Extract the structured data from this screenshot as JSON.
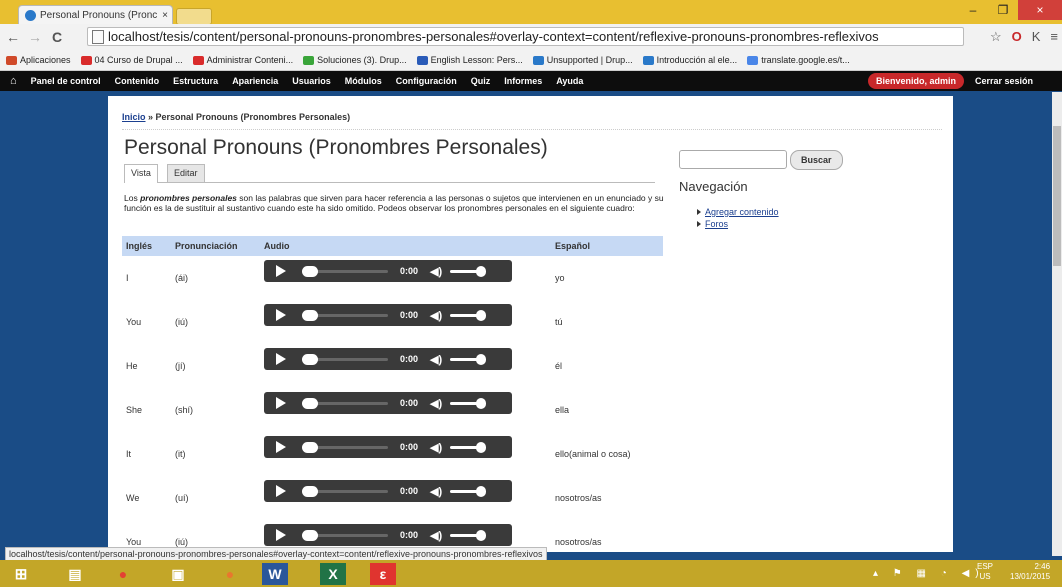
{
  "browser": {
    "tab_title": "Personal Pronouns (Pronc",
    "tab_close": "×",
    "window": {
      "minimize": "–",
      "maximize": "❐",
      "close": "×"
    },
    "url": "localhost/tesis/content/personal-pronouns-pronombres-personales#overlay-context=content/reflexive-pronouns-pronombres-reflexivos",
    "bookmarks": [
      {
        "label": "Aplicaciones",
        "color": "#d04a2a"
      },
      {
        "label": "04 Curso de Drupal ...",
        "color": "#d92b2b"
      },
      {
        "label": "Administrar Conteni...",
        "color": "#d92b2b"
      },
      {
        "label": "Soluciones (3). Drup...",
        "color": "#3aa53a"
      },
      {
        "label": "English Lesson: Pers...",
        "color": "#2a5bb8"
      },
      {
        "label": "Unsupported | Drup...",
        "color": "#2a79c9"
      },
      {
        "label": "Introducción al ele...",
        "color": "#2a79c9"
      },
      {
        "label": "translate.google.es/t...",
        "color": "#4a86e8"
      }
    ],
    "status_url": "localhost/tesis/content/personal-pronouns-pronombres-personales#overlay-context=content/reflexive-pronouns-pronombres-reflexivos"
  },
  "admin_bar": {
    "items": [
      "Panel de control",
      "Contenido",
      "Estructura",
      "Apariencia",
      "Usuarios",
      "Módulos",
      "Configuración",
      "Quiz",
      "Informes",
      "Ayuda"
    ],
    "welcome_prefix": "Bienvenido, ",
    "welcome_user": "admin",
    "logout": "Cerrar sesión"
  },
  "page": {
    "breadcrumb_link": "Inicio",
    "breadcrumb_sep": " » ",
    "breadcrumb_current": "Personal Pronouns (Pronombres Personales)",
    "title": "Personal Pronouns (Pronombres Personales)",
    "tabs": [
      "Vista",
      "Editar"
    ],
    "intro_prefix": "Los ",
    "intro_em": "pronombres personales",
    "intro_rest": " son las palabras que sirven para hacer referencia a las personas o sujetos que intervienen en un enunciado y su función es la de sustituir al sustantivo cuando este ha sido omitido. Podeos observar los pronombres personales en el siguiente cuadro:",
    "table": {
      "headers": [
        "Inglés",
        "Pronunciación",
        "Audio",
        "Español"
      ],
      "rows": [
        {
          "en": "I",
          "pron": "(ái)",
          "es": "yo",
          "time": "0:00"
        },
        {
          "en": "You",
          "pron": "(iú)",
          "es": "tú",
          "time": "0:00"
        },
        {
          "en": "He",
          "pron": "(jí)",
          "es": "él",
          "time": "0:00"
        },
        {
          "en": "She",
          "pron": "(shí)",
          "es": "ella",
          "time": "0:00"
        },
        {
          "en": "It",
          "pron": "(it)",
          "es": "ello(animal o cosa)",
          "time": "0:00"
        },
        {
          "en": "We",
          "pron": "(uí)",
          "es": "nosotros/as",
          "time": "0:00"
        },
        {
          "en": "You",
          "pron": "(iú)",
          "es": "nosotros/as",
          "time": "0:00"
        }
      ]
    }
  },
  "sidebar": {
    "search_button": "Buscar",
    "nav_title": "Navegación",
    "nav_links": [
      "Agregar contenido",
      "Foros"
    ]
  },
  "taskbar": {
    "lang_top": "ESP",
    "lang_bottom": "US",
    "time": "2:46",
    "date": "13/01/2015"
  }
}
